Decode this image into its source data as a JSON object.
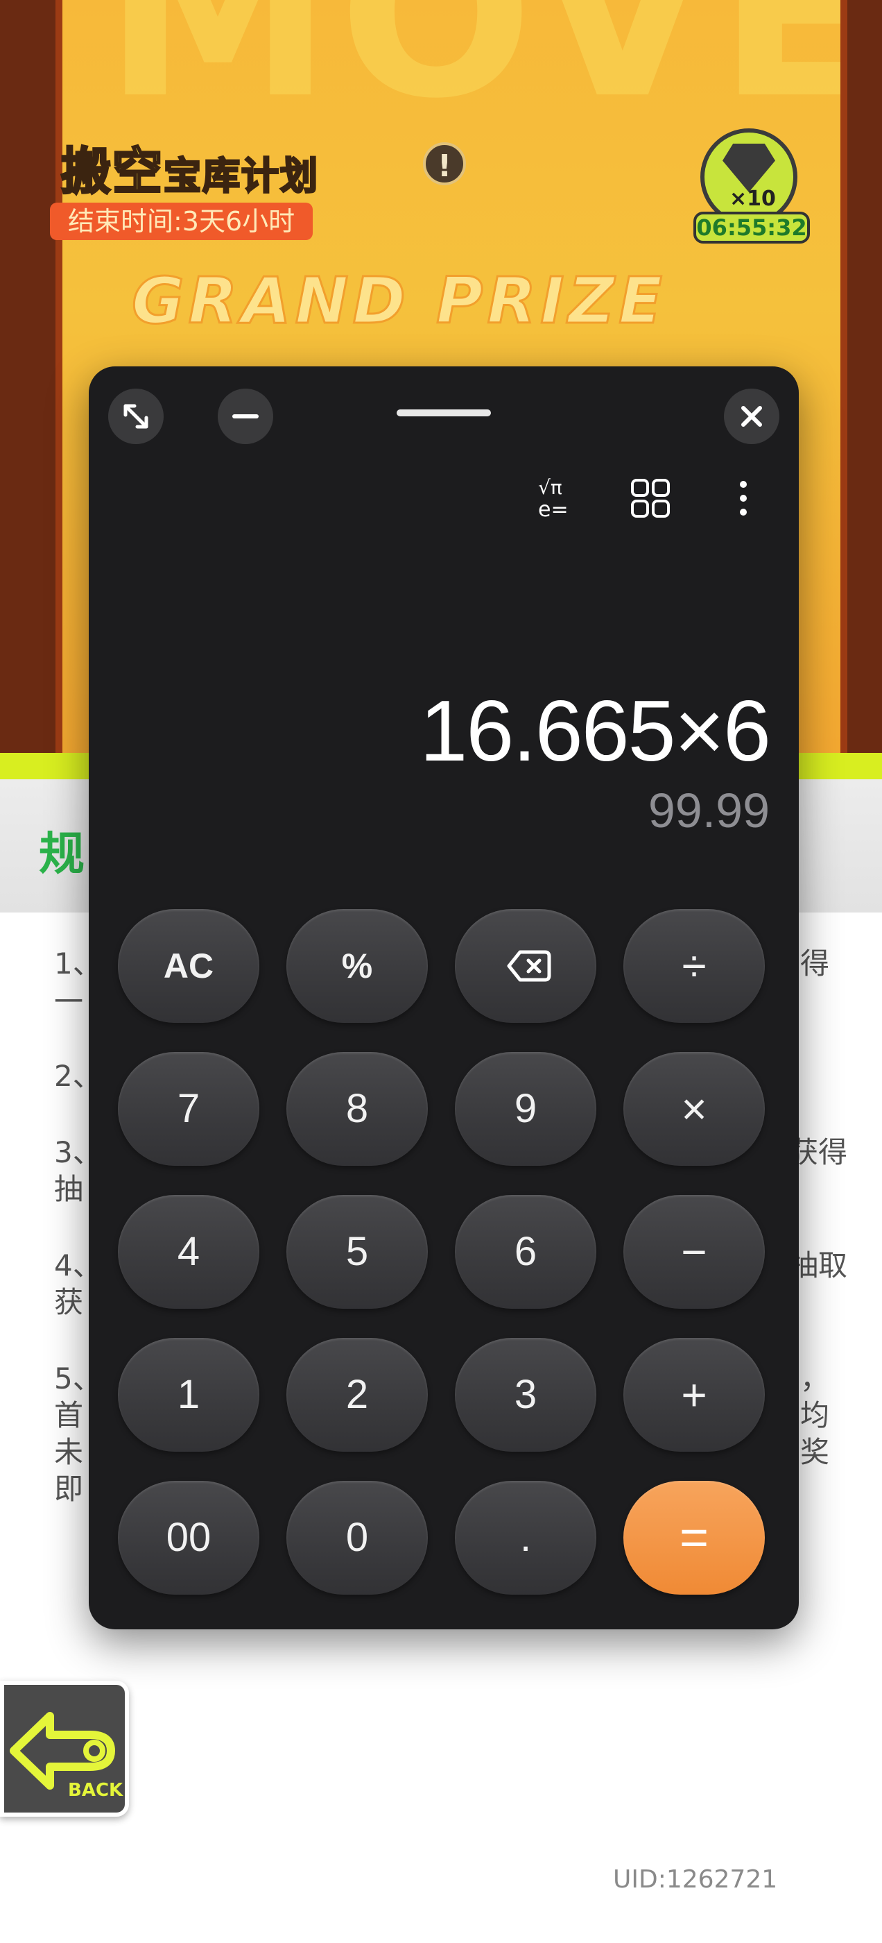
{
  "background": {
    "event_title_main": "搬空",
    "event_title_rest": "宝库计划",
    "info_symbol": "!",
    "end_time": "结束时间:3天6小时",
    "gem_count": "×10",
    "gem_timer": "06:55:32",
    "grand_prize": "GRAND PRIZE",
    "rules_title": "规",
    "rules": [
      {
        "num": "1、",
        "cont": "一",
        "tail": "得"
      },
      {
        "num": "2、",
        "cont": "",
        "tail": ""
      },
      {
        "num": "3、",
        "cont": "抽",
        "tail": "获得"
      },
      {
        "num": "4、",
        "cont": "获",
        "tail": "抽取"
      },
      {
        "num": "5、",
        "cont": "首",
        "tail": "，"
      }
    ],
    "rule5_lines": [
      "未",
      "即"
    ],
    "rule5_tails": [
      "均",
      "奖"
    ],
    "back_label": "BACK",
    "uid": "UID:1262721"
  },
  "calculator": {
    "window_buttons": [
      "expand-icon",
      "minimize-icon",
      "close-icon"
    ],
    "toolbar": {
      "scientific_icon_text_top": "√π",
      "scientific_icon_text_bottom": "e=",
      "icons": [
        "scientific-icon",
        "grid-icon",
        "more-vertical-icon"
      ]
    },
    "expression": "16.665×6",
    "result": "99.99",
    "keys": [
      [
        "AC",
        "%",
        "⌫",
        "÷"
      ],
      [
        "7",
        "8",
        "9",
        "×"
      ],
      [
        "4",
        "5",
        "6",
        "−"
      ],
      [
        "1",
        "2",
        "3",
        "+"
      ],
      [
        "00",
        "0",
        ".",
        "="
      ]
    ],
    "colors": {
      "window_bg": "#1c1c1e",
      "key_bg": "#3a3a3d",
      "equals_bg": "#f08a35",
      "expression_color": "#ffffff",
      "result_color": "#8e8e93"
    }
  }
}
